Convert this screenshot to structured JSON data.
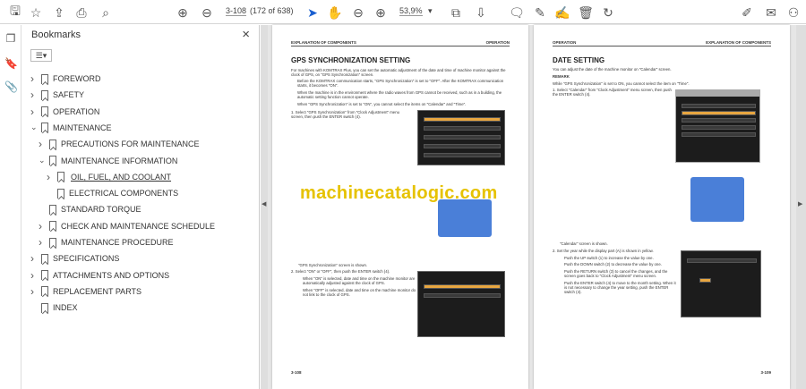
{
  "toolbar": {
    "page_input": "3-108",
    "page_count": "(172 of 638)",
    "zoom": "53,9%",
    "icons": [
      "save-icon",
      "bookmark-star-icon",
      "upload-icon",
      "print-icon",
      "search-icon",
      "page-up-icon",
      "page-down-icon",
      "select-cursor-icon",
      "hand-icon",
      "zoom-out-icon",
      "zoom-in-icon",
      "fit-page-icon",
      "scroll-mode-icon",
      "comment-icon",
      "highlight-icon",
      "sign-icon",
      "delete-icon",
      "rotate-icon",
      "share-icon",
      "email-icon",
      "account-icon"
    ]
  },
  "panel": {
    "title": "Bookmarks",
    "bookmarks": [
      {
        "label": "FOREWORD",
        "level": 0,
        "expandable": true,
        "expanded": false
      },
      {
        "label": "SAFETY",
        "level": 0,
        "expandable": true,
        "expanded": false
      },
      {
        "label": "OPERATION",
        "level": 0,
        "expandable": true,
        "expanded": false
      },
      {
        "label": "MAINTENANCE",
        "level": 0,
        "expandable": true,
        "expanded": true
      },
      {
        "label": "PRECAUTIONS FOR MAINTENANCE",
        "level": 1,
        "expandable": true,
        "expanded": false
      },
      {
        "label": "MAINTENANCE INFORMATION",
        "level": 1,
        "expandable": true,
        "expanded": true
      },
      {
        "label": "OIL, FUEL, AND COOLANT",
        "level": 2,
        "expandable": true,
        "expanded": false,
        "selected": true
      },
      {
        "label": "ELECTRICAL COMPONENTS",
        "level": 2,
        "expandable": false
      },
      {
        "label": "STANDARD TORQUE",
        "level": 1,
        "expandable": false
      },
      {
        "label": "CHECK AND MAINTENANCE SCHEDULE",
        "level": 1,
        "expandable": true,
        "expanded": false
      },
      {
        "label": "MAINTENANCE PROCEDURE",
        "level": 1,
        "expandable": true,
        "expanded": false
      },
      {
        "label": "SPECIFICATIONS",
        "level": 0,
        "expandable": true,
        "expanded": false
      },
      {
        "label": "ATTACHMENTS AND OPTIONS",
        "level": 0,
        "expandable": true,
        "expanded": false
      },
      {
        "label": "REPLACEMENT PARTS",
        "level": 0,
        "expandable": true,
        "expanded": false
      },
      {
        "label": "INDEX",
        "level": 0,
        "expandable": false
      }
    ]
  },
  "left_page": {
    "header_left": "EXPLANATION OF COMPONENTS",
    "header_right": "OPERATION",
    "title": "GPS SYNCHRONIZATION SETTING",
    "intro": "For machines with KOMTRAX Plus, you can set the automatic adjustment of the date and time of machine monitor against the clock of GPS, on \"GPS Synchronization\" screen.",
    "bullets": [
      "Before the KOMTRAX communication starts, \"GPS Synchronization\" is set to \"OFF\". After the KOMTRAX communication starts, it becomes \"ON\".",
      "When the machine is in the environment where the radio waves from GPS cannot be received, such as in a building, the automatic setting function cannot operate.",
      "When \"GPS Synchronization\" is set to \"ON\", you cannot select the items on \"Calendar\" and \"Time\"."
    ],
    "step1": "1.   Select \"GPS Synchronization\" from \"Clock Adjustment\" menu screen, then push the ENTER switch (4).",
    "shown": "\"GPS Synchronization\" screen is shown.",
    "step2": "2.   Select \"ON\" or \"OFF\", then push the ENTER switch (4).",
    "step2_bullets": [
      "When \"ON\" is selected, date and time on the machine monitor are automatically adjusted against the clock of GPS.",
      "When \"OFF\" is selected, date and time on the machine monitor do not link to the clock of GPS."
    ],
    "footer": "3-108"
  },
  "right_page": {
    "header_left": "OPERATION",
    "header_right": "EXPLANATION OF COMPONENTS",
    "title": "DATE SETTING",
    "intro": "You can adjust the date of the machine monitor on \"Calendar\" screen.",
    "remark_title": "REMARK",
    "remark": "While \"GPS Synchronization\" is set to ON, you cannot select the item on \"Time\".",
    "step1": "1.   Select \"Calendar\" from \"Clock Adjustment\" menu screen, then push the ENTER switch (4).",
    "shown": "\"Calendar\" screen is shown.",
    "step2": "2.   Set the year while the display part (A) is shown in yellow.",
    "step2_bullets": [
      "Push the UP switch (1) to increase the value by one.",
      "Push the DOWN switch (2) to decrease the value by one.",
      "Push the RETURN switch (3) to cancel the changes, and the screen goes back to \"Clock Adjustment\" menu screen.",
      "Push the ENTER switch (4) to move to the month setting. When it is not necessary to change the year setting, push the ENTER switch (4)."
    ],
    "footer": "3-109"
  },
  "watermark": "machinecatalogic.com"
}
